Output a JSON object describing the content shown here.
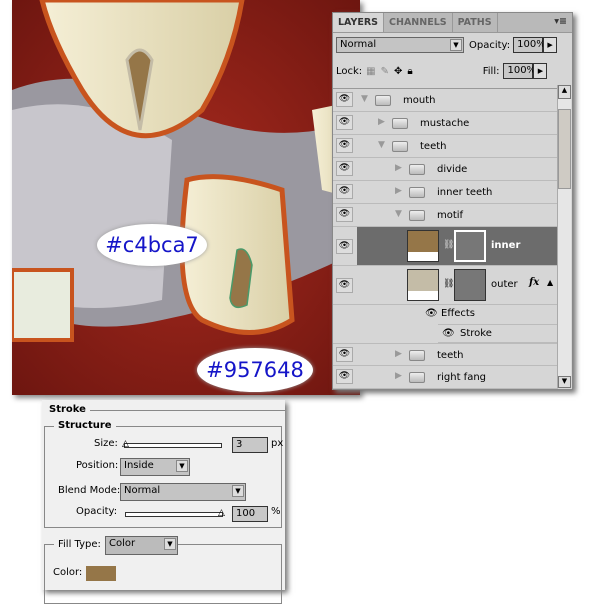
{
  "artwork": {
    "callouts": [
      {
        "text": "#c4bca7"
      },
      {
        "text": "#957648"
      }
    ]
  },
  "layers_panel": {
    "tabs": [
      "LAYERS",
      "CHANNELS",
      "PATHS"
    ],
    "blend_mode": "Normal",
    "opacity_label": "Opacity:",
    "opacity": "100%",
    "lock_label": "Lock:",
    "fill_label": "Fill:",
    "fill": "100%",
    "layers": [
      {
        "name": "mouth",
        "type": "group",
        "expanded": true
      },
      {
        "name": "mustache",
        "type": "group",
        "expanded": false
      },
      {
        "name": "teeth",
        "type": "group",
        "expanded": true
      },
      {
        "name": "divide",
        "type": "group",
        "expanded": false
      },
      {
        "name": "inner teeth",
        "type": "group",
        "expanded": false
      },
      {
        "name": "motif",
        "type": "group",
        "expanded": true
      },
      {
        "name": "inner",
        "type": "layer",
        "selected": true,
        "color": "#957648"
      },
      {
        "name": "outer",
        "type": "layer",
        "color": "#c4bca7",
        "fx": "fx"
      },
      {
        "name": "Effects",
        "type": "effects"
      },
      {
        "name": "Stroke",
        "type": "effect"
      },
      {
        "name": "teeth",
        "type": "group",
        "expanded": false
      },
      {
        "name": "right fang",
        "type": "group",
        "expanded": false
      }
    ]
  },
  "stroke_dialog": {
    "title": "Stroke",
    "structure": "Structure",
    "size_label": "Size:",
    "size": "3",
    "size_unit": "px",
    "size_slider": 0.03,
    "position_label": "Position:",
    "position": "Inside",
    "blend_label": "Blend Mode:",
    "blend": "Normal",
    "opacity_label": "Opacity:",
    "opacity": "100",
    "opacity_unit": "%",
    "opacity_slider": 1.0,
    "fill_type_label": "Fill Type:",
    "fill_type": "Color",
    "color_label": "Color:",
    "color": "#957648"
  }
}
